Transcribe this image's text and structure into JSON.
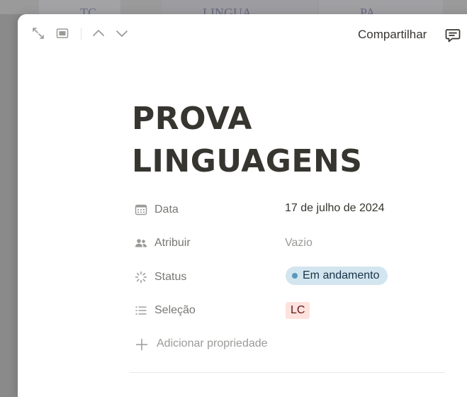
{
  "background": {
    "columns": [
      {
        "text": "TC"
      },
      {
        "text": "LINGUA"
      },
      {
        "text": "PA"
      }
    ]
  },
  "topbar": {
    "icons": [
      "expand-icon",
      "peek-mode-icon",
      "chevron-up-icon",
      "chevron-down-icon",
      "comment-icon"
    ],
    "share_label": "Compartilhar"
  },
  "page": {
    "title_line1": "PROVA",
    "title_line2": "LINGUAGENS"
  },
  "properties": {
    "date": {
      "name": "Data",
      "value": "17 de julho de 2024",
      "icon": "calendar-icon"
    },
    "assign": {
      "name": "Atribuir",
      "value": "Vazio",
      "icon": "people-icon"
    },
    "status": {
      "name": "Status",
      "value": "Em andamento",
      "icon": "status-loader-icon"
    },
    "selection": {
      "name": "Seleção",
      "value": "LC",
      "icon": "list-icon"
    },
    "add_label": "Adicionar propriedade"
  },
  "colors": {
    "text": "#37352f",
    "muted": "#787774",
    "status_bg": "#d3e5ef",
    "status_dot": "#5b97bd",
    "tag_bg": "#ffe2dd"
  }
}
